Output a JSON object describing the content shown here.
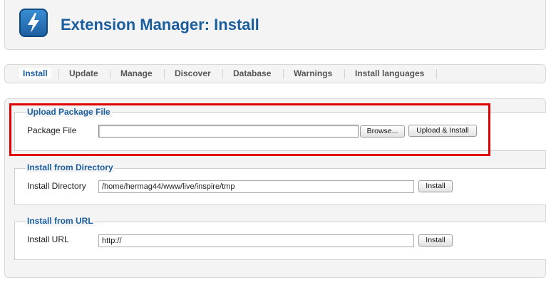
{
  "header": {
    "title": "Extension Manager: Install",
    "logo_icon": "lightning-bolt-icon"
  },
  "tabs": [
    {
      "label": "Install",
      "active": true
    },
    {
      "label": "Update",
      "active": false
    },
    {
      "label": "Manage",
      "active": false
    },
    {
      "label": "Discover",
      "active": false
    },
    {
      "label": "Database",
      "active": false
    },
    {
      "label": "Warnings",
      "active": false
    },
    {
      "label": "Install languages",
      "active": false
    }
  ],
  "upload": {
    "legend": "Upload Package File",
    "field_label": "Package File",
    "value": "",
    "browse_label": "Browse...",
    "submit_label": "Upload & Install"
  },
  "directory": {
    "legend": "Install from Directory",
    "field_label": "Install Directory",
    "value": "/home/hermag44/www/live/inspire/tmp",
    "submit_label": "Install"
  },
  "url": {
    "legend": "Install from URL",
    "field_label": "Install URL",
    "value": "http://",
    "submit_label": "Install"
  },
  "colors": {
    "accent": "#1b5e9e",
    "highlight": "#e00000",
    "panel_bg": "#f4f4f4"
  }
}
